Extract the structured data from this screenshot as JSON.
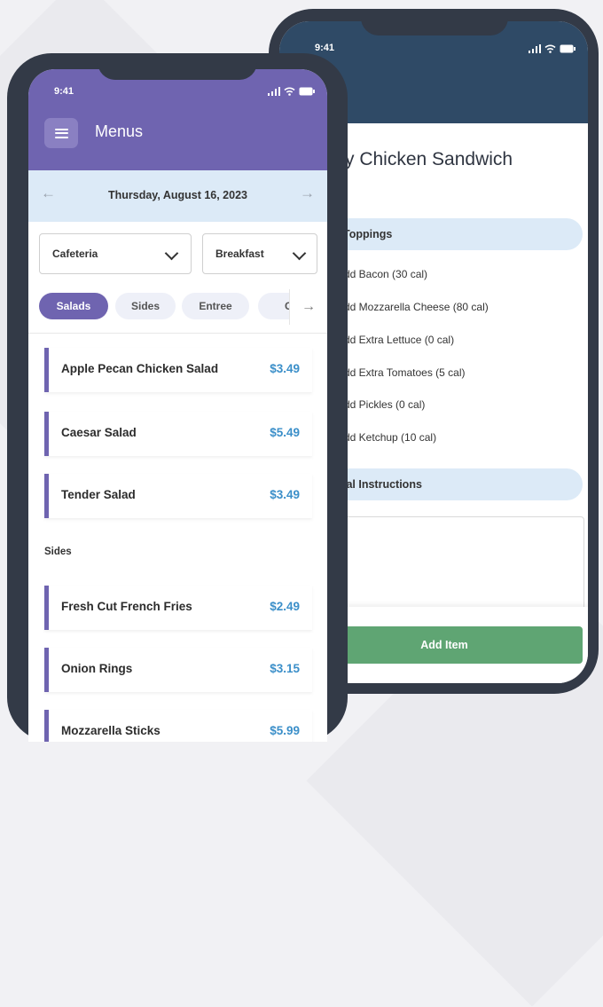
{
  "back_phone": {
    "time": "9:41",
    "item_title": "y Chicken Sandwich",
    "toppings_header": "Toppings",
    "toppings": [
      "dd Bacon (30 cal)",
      "dd Mozzarella Cheese (80 cal)",
      "dd Extra Lettuce (0 cal)",
      "dd Extra Tomatoes (5 cal)",
      "dd Pickles (0 cal)",
      "dd Ketchup (10 cal)"
    ],
    "instructions_header": "ial Instructions",
    "add_button": "Add Item"
  },
  "front_phone": {
    "time": "9:41",
    "title": "Menus",
    "date": "Thursday, August 16, 2023",
    "prev_arrow": "←",
    "next_arrow": "→",
    "location_select": "Cafeteria",
    "meal_select": "Breakfast",
    "chips": [
      "Salads",
      "Sides",
      "Entree",
      "Col"
    ],
    "chip_arrow": "→",
    "items": [
      {
        "name": "Apple Pecan Chicken Salad",
        "price": "$3.49"
      },
      {
        "name": "Caesar Salad",
        "price": "$5.49"
      },
      {
        "name": "Tender Salad",
        "price": "$3.49"
      }
    ],
    "section_sides": "Sides",
    "side_items": [
      {
        "name": "Fresh Cut French Fries",
        "price": "$2.49"
      },
      {
        "name": "Onion Rings",
        "price": "$3.15"
      },
      {
        "name": "Mozzarella Sticks",
        "price": "$5.99"
      }
    ]
  },
  "colors": {
    "purple": "#6f64b0",
    "navy": "#2f4a66",
    "light_blue": "#dceaf7",
    "green": "#5fa573",
    "price_blue": "#3b8fc9"
  },
  "icons": [
    "menu-icon",
    "signal-icon",
    "wifi-icon",
    "battery-icon",
    "arrow-left-icon",
    "arrow-right-icon",
    "chevron-down-icon"
  ]
}
